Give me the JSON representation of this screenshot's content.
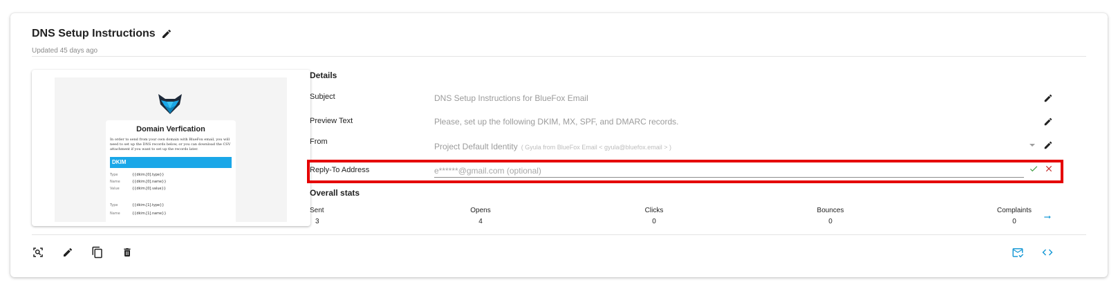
{
  "header": {
    "title": "DNS Setup Instructions",
    "updated": "Updated 45 days ago"
  },
  "preview": {
    "email_title": "Domain Verfication",
    "intro": "In order to send from your own domain with BlueFox email, you will need to set up the DNS records below, or you can download the CSV attachment if you want to set up the records later.",
    "dkim_heading": "DKIM",
    "records": [
      {
        "key": "Type",
        "value": "{{dkim.[0].type}}"
      },
      {
        "key": "Name",
        "value": "{{dkim.[0].name}}"
      },
      {
        "key": "Value",
        "value": "{{dkim.[0].value}}"
      },
      {
        "key": "Type",
        "value": "{{dkim.[1].type}}"
      },
      {
        "key": "Name",
        "value": "{{dkim.[1].name}}"
      }
    ]
  },
  "details": {
    "heading": "Details",
    "subject_label": "Subject",
    "subject_value": "DNS Setup Instructions for BlueFox Email",
    "preview_label": "Preview Text",
    "preview_value": "Please, set up the following DKIM, MX, SPF, and DMARC records.",
    "from_label": "From",
    "from_value": "Project Default Identity",
    "from_sub": "( Gyula from BlueFox Email < gyula@bluefox.email > )",
    "reply_label": "Reply-To Address",
    "reply_placeholder": "e******@gmail.com (optional)",
    "reply_value": ""
  },
  "stats": {
    "heading": "Overall stats",
    "items": [
      {
        "label": "Sent",
        "value": "3"
      },
      {
        "label": "Opens",
        "value": "4"
      },
      {
        "label": "Clicks",
        "value": "0"
      },
      {
        "label": "Bounces",
        "value": "0"
      },
      {
        "label": "Complaints",
        "value": "0"
      }
    ]
  },
  "icons": {
    "title_edit": "pencil-icon",
    "stats_more": "arrow-right-icon",
    "confirm": "check-icon",
    "cancel": "close-icon",
    "toolbar_left": [
      "zoom-in-icon",
      "pencil-icon",
      "copy-icon",
      "delete-icon"
    ],
    "toolbar_right": [
      "mark-email-read-icon",
      "code-icon"
    ]
  },
  "colors": {
    "accent": "#1a9ad6",
    "confirm": "#43a047",
    "cancel": "#c62828",
    "highlight": "#e50000",
    "dkim_bar": "#1aa7e8"
  }
}
